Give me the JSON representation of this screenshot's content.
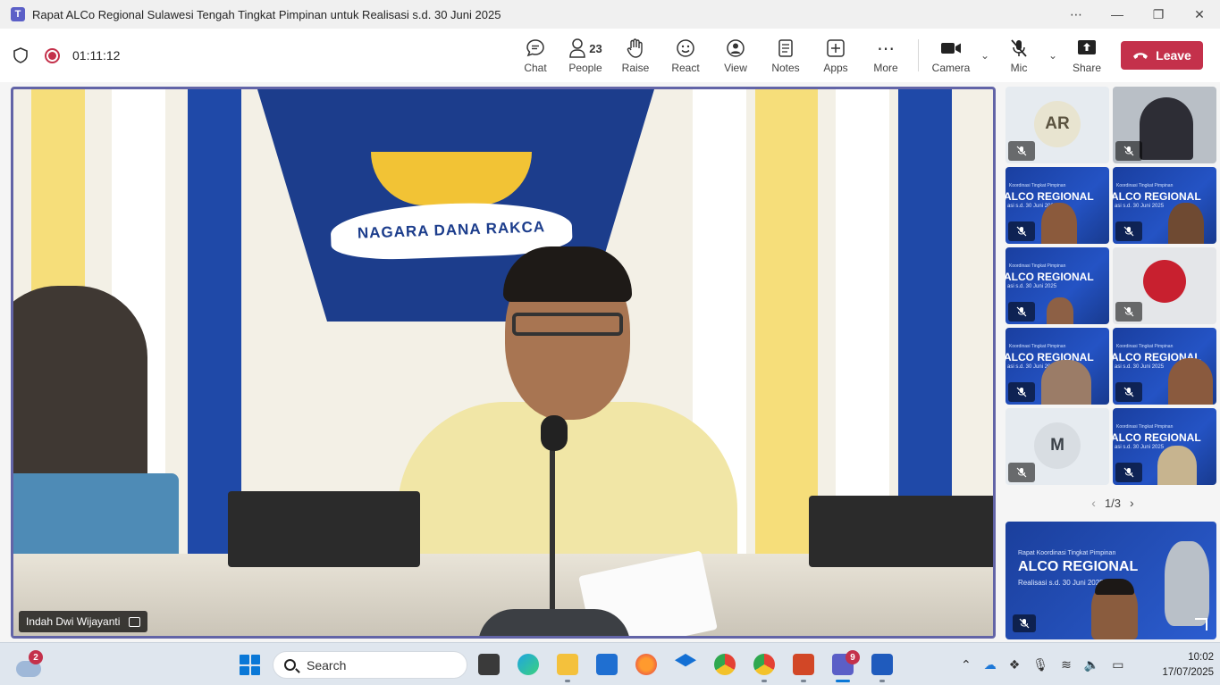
{
  "window": {
    "title": "Rapat ALCo Regional Sulawesi Tengah Tingkat Pimpinan untuk Realisasi s.d. 30 Juni 2025",
    "controls": [
      "more-icon",
      "minimize-icon",
      "maximize-icon",
      "close-icon"
    ]
  },
  "meeting": {
    "timer": "01:11:12",
    "people_count": "23",
    "actions": {
      "chat": "Chat",
      "people": "People",
      "raise": "Raise",
      "react": "React",
      "view": "View",
      "notes": "Notes",
      "apps": "Apps",
      "more": "More",
      "camera": "Camera",
      "mic": "Mic",
      "share": "Share"
    },
    "leave": "Leave",
    "accent_color": "#6264a7",
    "leave_color": "#c4314b"
  },
  "stage": {
    "speaker_name": "Indah Dwi Wijayanti",
    "banner_text": "NAGARA DANA RAKCA"
  },
  "gallery": {
    "tiles": [
      {
        "type": "avatar",
        "initials": "AR",
        "muted": true
      },
      {
        "type": "video",
        "muted": true
      },
      {
        "type": "slide",
        "muted": true
      },
      {
        "type": "slide",
        "muted": true
      },
      {
        "type": "slide",
        "muted": true
      },
      {
        "type": "photo",
        "muted": true
      },
      {
        "type": "slide",
        "muted": true
      },
      {
        "type": "slide",
        "muted": true
      },
      {
        "type": "avatar",
        "initials": "M",
        "muted": true
      },
      {
        "type": "slide",
        "muted": true
      }
    ],
    "slide_small": "Koordinasi Tingkat Pimpinan",
    "slide_big": "ALCO REGIONAL",
    "slide_sub": "asi s.d. 30 Juni 2025",
    "pager": "1/3"
  },
  "featured": {
    "small": "Rapat Koordinasi Tingkat Pimpinan",
    "big": "ALCO REGIONAL",
    "sub": "Realisasi s.d. 30 Juni 2025"
  },
  "taskbar": {
    "weather_badge": "2",
    "search_label": "Search",
    "teams_badge": "9",
    "time": "10:02",
    "date": "17/07/2025"
  }
}
